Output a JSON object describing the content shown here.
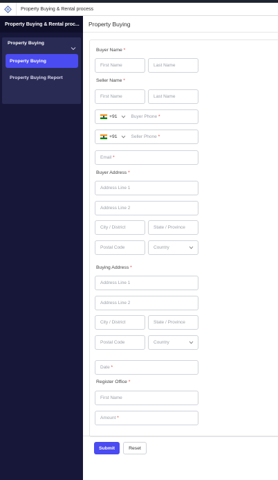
{
  "app": {
    "title": "Property Buying & Rental process",
    "logo": "diamond-logo-icon"
  },
  "sidebar": {
    "header": "Property Buying & Rental proc...",
    "group": {
      "title": "Property Buying",
      "icon": "chevron-down-icon"
    },
    "items": [
      {
        "label": "Property Buying",
        "active": true
      },
      {
        "label": "Property Buying Report",
        "active": false
      }
    ]
  },
  "page": {
    "title": "Property Buying"
  },
  "form": {
    "buyer_name_label": "Buyer Name",
    "buyer_first_ph": "First Name",
    "buyer_last_ph": "Last Name",
    "seller_name_label": "Seller Name",
    "seller_first_ph": "First Name",
    "seller_last_ph": "Last Name",
    "country_code": "+91",
    "buyer_phone_ph": "Buyer Phone",
    "seller_phone_ph": "Seller Phone",
    "email_ph": "Email",
    "buyer_address_label": "Buyer Address",
    "address_line1_ph": "Address Line 1",
    "address_line2_ph": "Address Line 2",
    "city_ph": "City / District",
    "state_ph": "State / Province",
    "postal_ph": "Postal Code",
    "country_ph": "Country",
    "buying_address_label": "Buying Address",
    "date_ph": "Date",
    "register_office_label": "Register Office",
    "ro_first_ph": "First Name",
    "amount_ph": "Amount",
    "required_mark": "*"
  },
  "actions": {
    "submit": "Submit",
    "reset": "Reset"
  },
  "colors": {
    "accent": "#4a4bf0",
    "sidebar_bg": "#17173a",
    "required": "#e03b3b"
  }
}
